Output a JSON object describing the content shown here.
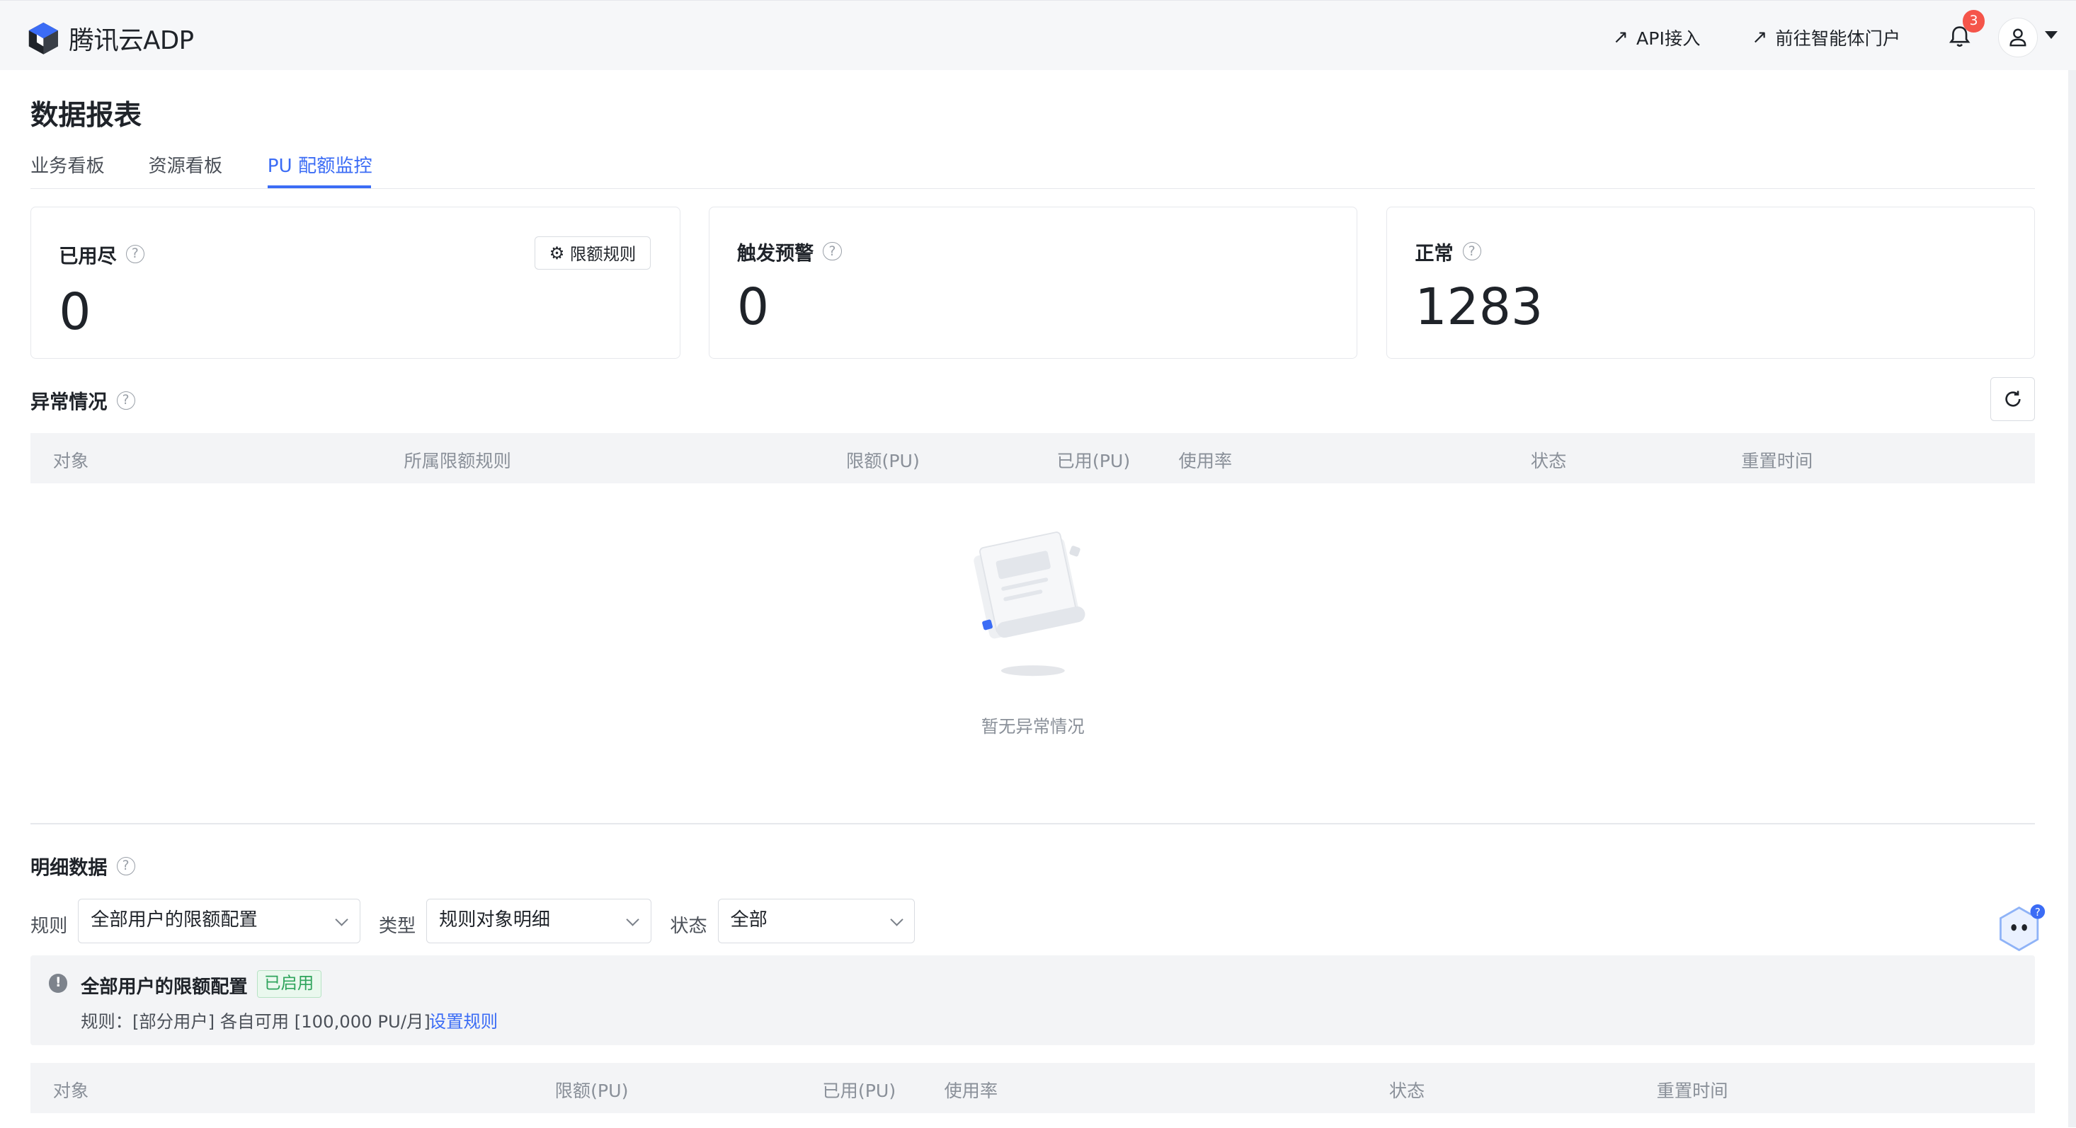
{
  "header": {
    "brand": "腾讯云ADP",
    "links": [
      {
        "label": "API接入",
        "icon": "external-arrow-icon"
      },
      {
        "label": "前往智能体门户",
        "icon": "external-arrow-icon"
      }
    ],
    "notification_count": "3"
  },
  "page": {
    "title": "数据报表"
  },
  "tabs": [
    {
      "label": "业务看板",
      "active": false
    },
    {
      "label": "资源看板",
      "active": false
    },
    {
      "label": "PU 配额监控",
      "active": true
    }
  ],
  "cards": [
    {
      "title": "已用尽",
      "value": "0",
      "button": "限额规则"
    },
    {
      "title": "触发预警",
      "value": "0"
    },
    {
      "title": "正常",
      "value": "1283"
    }
  ],
  "anomalies": {
    "title": "异常情况",
    "columns": [
      "对象",
      "所属限额规则",
      "限额(PU)",
      "已用(PU)",
      "使用率",
      "状态",
      "重置时间"
    ],
    "empty_text": "暂无异常情况"
  },
  "details": {
    "title": "明细数据",
    "filters": [
      {
        "label": "规则",
        "value": "全部用户的限额配置"
      },
      {
        "label": "类型",
        "value": "规则对象明细"
      },
      {
        "label": "状态",
        "value": "全部"
      }
    ],
    "rule_info": {
      "name": "全部用户的限额配置",
      "status": "已启用",
      "rule_text": "规则：[部分用户] 各自可用 [100,000 PU/月]",
      "link": "设置规则"
    },
    "columns": [
      "对象",
      "限额(PU)",
      "已用(PU)",
      "使用率",
      "状态",
      "重置时间"
    ]
  },
  "colors": {
    "accent": "#3b6cf5",
    "success": "#2fa45c",
    "badge": "#f5554a"
  }
}
